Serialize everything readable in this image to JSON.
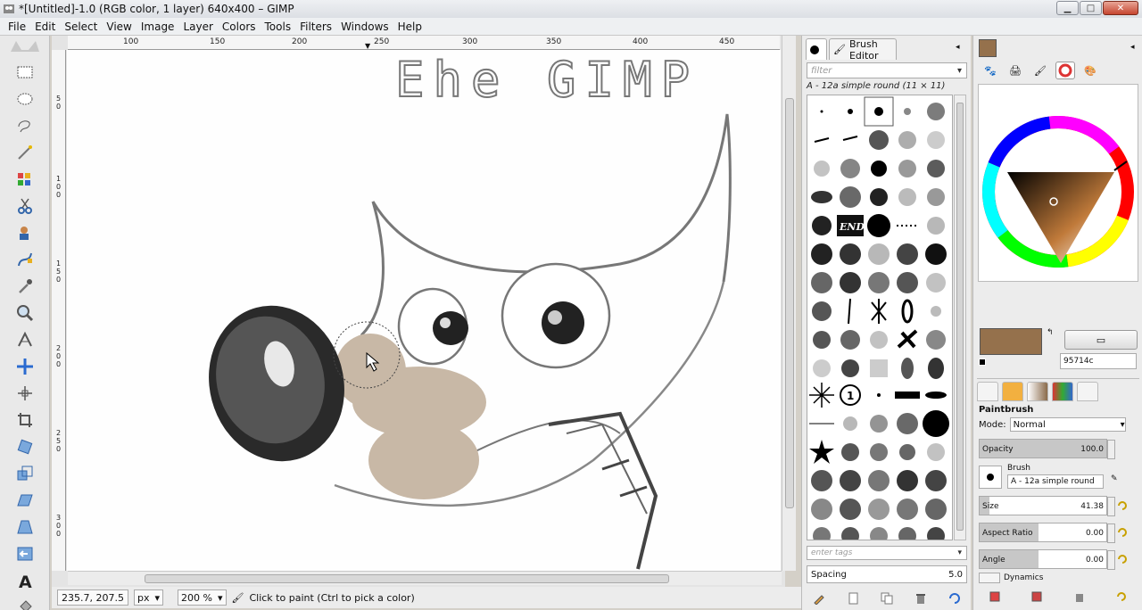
{
  "window": {
    "title": "*[Untitled]-1.0 (RGB color, 1 layer) 640x400 – GIMP"
  },
  "menu": [
    "File",
    "Edit",
    "Select",
    "View",
    "Image",
    "Layer",
    "Colors",
    "Tools",
    "Filters",
    "Windows",
    "Help"
  ],
  "ruler": {
    "h": [
      "100",
      "150",
      "200",
      "250",
      "300",
      "350",
      "400",
      "450"
    ],
    "v": [
      "5\n0",
      "1\n0\n0",
      "1\n5\n0",
      "2\n0\n0",
      "2\n5\n0",
      "3\n0\n0"
    ]
  },
  "canvas_text": "Ehe GIMP",
  "status": {
    "coords": "235.7, 207.5",
    "unit": "px",
    "zoom": "200 %",
    "message": "Click to paint (Ctrl to pick a color)"
  },
  "brushes": {
    "tab_label": "Brush Editor",
    "filter_placeholder": "filter",
    "selected": "A - 12a simple round (11 × 11)",
    "tags_placeholder": "enter tags",
    "spacing_label": "Spacing",
    "spacing_value": "5.0",
    "end_label": "END"
  },
  "colors": {
    "fg": "#95714c",
    "hex": "95714c"
  },
  "tool_options": {
    "tool": "Paintbrush",
    "mode_label": "Mode:",
    "mode": "Normal",
    "opacity_label": "Opacity",
    "opacity": "100.0",
    "opacity_fraction": 1.0,
    "brush_label": "Brush",
    "brush_name": "A - 12a simple round",
    "size_label": "Size",
    "size": "41.38",
    "size_fraction": 0.08,
    "aspect_label": "Aspect Ratio",
    "aspect": "0.00",
    "angle_label": "Angle",
    "angle": "0.00",
    "dynamics_label": "Dynamics"
  }
}
